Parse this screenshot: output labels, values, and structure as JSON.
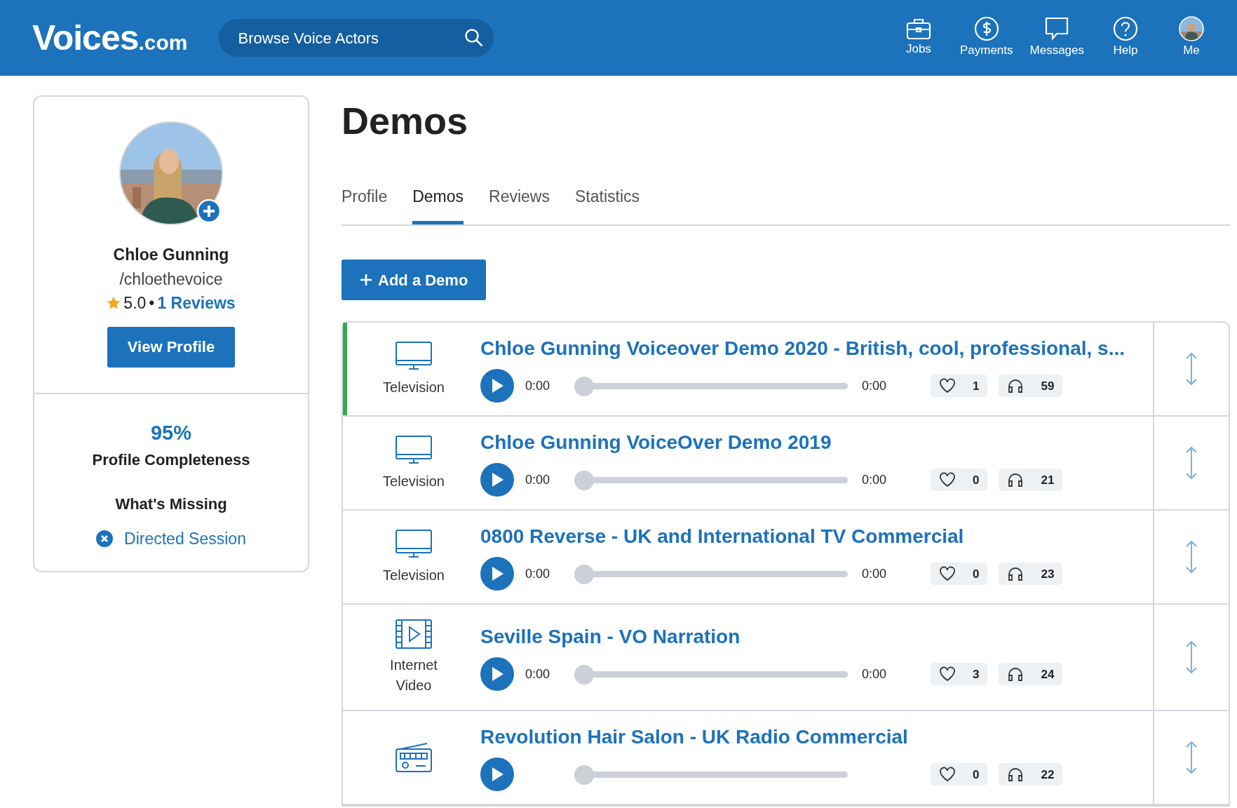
{
  "header": {
    "logo": {
      "main": "Voices",
      "suffix": ".com"
    },
    "search": {
      "placeholder": "Browse Voice Actors"
    },
    "nav": [
      {
        "kind": "jobs",
        "label": "Jobs"
      },
      {
        "kind": "payments",
        "label": "Payments"
      },
      {
        "kind": "messages",
        "label": "Messages"
      },
      {
        "kind": "help",
        "label": "Help"
      },
      {
        "kind": "avatar",
        "label": "Me"
      }
    ]
  },
  "profile_card": {
    "name": "Chloe Gunning",
    "handle": "/chloethevoice",
    "rating": "5.0",
    "separator": "•",
    "reviews_link": "1 Reviews",
    "view_button": "View Profile",
    "completeness": "95%",
    "completeness_label": "Profile Completeness",
    "missing_title": "What's Missing",
    "missing_items": [
      "Directed Session"
    ]
  },
  "page_title": "Demos",
  "tabs": [
    {
      "label": "Profile",
      "selected": false
    },
    {
      "label": "Demos",
      "selected": true
    },
    {
      "label": "Reviews",
      "selected": false
    },
    {
      "label": "Statistics",
      "selected": false
    }
  ],
  "add_button": "Add a Demo",
  "demos": [
    {
      "category": "Television",
      "kind": "tv",
      "title": "Chloe Gunning Voiceover Demo 2020 - British, cool, professional, s...",
      "selected": true,
      "elapsed": "0:00",
      "duration": "0:00",
      "level": 0,
      "likes": "1",
      "listens": "59"
    },
    {
      "category": "Television",
      "kind": "tv",
      "title": "Chloe Gunning VoiceOver Demo 2019",
      "selected": false,
      "elapsed": "0:00",
      "duration": "0:00",
      "level": 0,
      "likes": "0",
      "listens": "21"
    },
    {
      "category": "Television",
      "kind": "tv",
      "title": "0800 Reverse - UK and International TV Commercial",
      "selected": false,
      "elapsed": "0:00",
      "duration": "0:00",
      "level": 0,
      "likes": "0",
      "listens": "23"
    },
    {
      "category": "Internet Video",
      "kind": "video",
      "title": "Seville Spain - VO Narration",
      "selected": false,
      "elapsed": "0:00",
      "duration": "0:00",
      "level": 0,
      "likes": "3",
      "listens": "24"
    },
    {
      "kind": "radio",
      "title": "Revolution Hair Salon - UK Radio Commercial",
      "selected": false,
      "level": 0,
      "likes": "0",
      "listens": "22"
    }
  ]
}
